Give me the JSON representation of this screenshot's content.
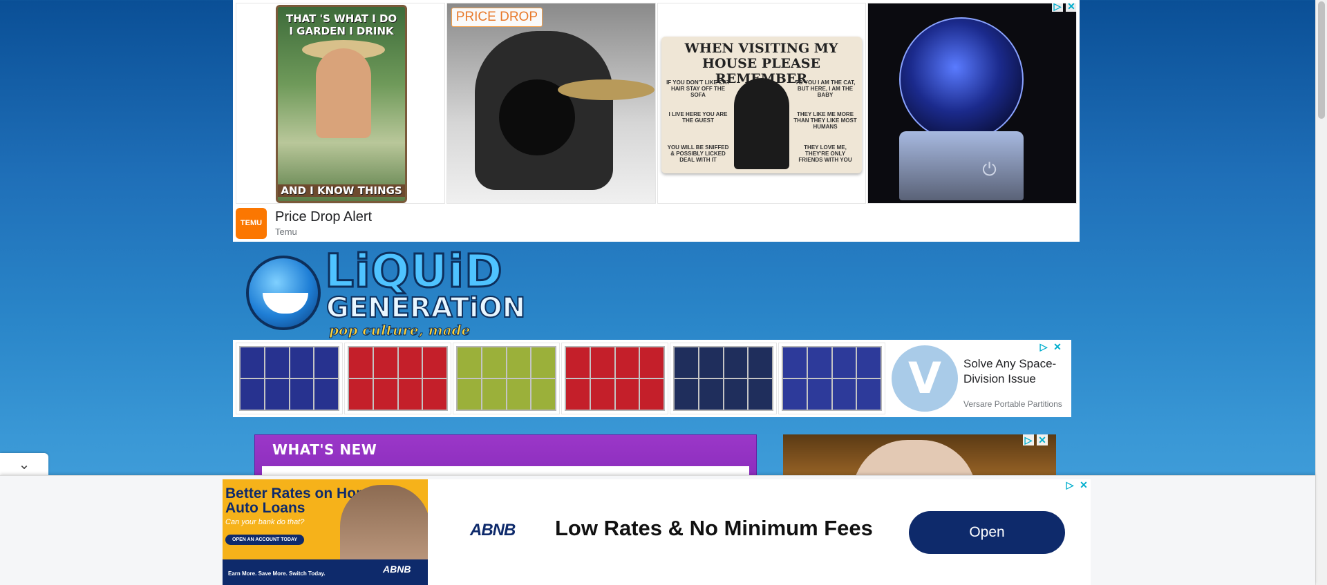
{
  "top_ad": {
    "badge": "PRICE DROP",
    "tile1": {
      "line1": "THAT 'S WHAT I DO",
      "line2": "I GARDEN I DRINK",
      "footer": "AND I KNOW THINGS"
    },
    "tile3": {
      "heading": "WHEN VISITING MY HOUSE PLEASE REMEMBER",
      "left": [
        "IF YOU DON'T LIKE CAT HAIR STAY OFF THE SOFA",
        "I LIVE HERE YOU ARE THE GUEST",
        "YOU WILL BE SNIFFED & POSSIBLY LICKED DEAL WITH IT"
      ],
      "right": [
        "TO YOU I AM THE CAT, BUT HERE, I AM THE BABY",
        "THEY LIKE ME MORE THAN THEY LIKE MOST HUMANS",
        "THEY LOVE ME, THEY'RE ONLY FRIENDS WITH YOU"
      ]
    },
    "title": "Price Drop Alert",
    "advertiser": "Temu",
    "logo_text": "TEMU"
  },
  "site": {
    "logo_line1": "LiQUiD",
    "logo_line2": "GENERATiON",
    "tagline": "pop culture, made funny."
  },
  "partitions_ad": {
    "colors": [
      "#27328f",
      "#c41f2a",
      "#9bb03a",
      "#c41f2a",
      "#1f2e5c",
      "#2d3a9a"
    ],
    "logo_letter": "V",
    "headline": "Solve Any Space-Division Issue",
    "advertiser": "Versare Portable Partitions"
  },
  "content": {
    "whats_new": "WHAT'S NEW"
  },
  "anchor_ad": {
    "creative_headline": "Better Rates on Home & Auto Loans",
    "creative_sub": "Can your bank do that?",
    "creative_cta": "OPEN AN ACCOUNT TODAY",
    "creative_footer": "Earn More. Save More. Switch Today.",
    "creative_logo": "ABNB",
    "brand": "ABNB",
    "headline": "Low Rates & No Minimum Fees",
    "cta": "Open"
  },
  "icons": {
    "adchoices": "▷",
    "close": "✕",
    "collapse": "⌄"
  }
}
